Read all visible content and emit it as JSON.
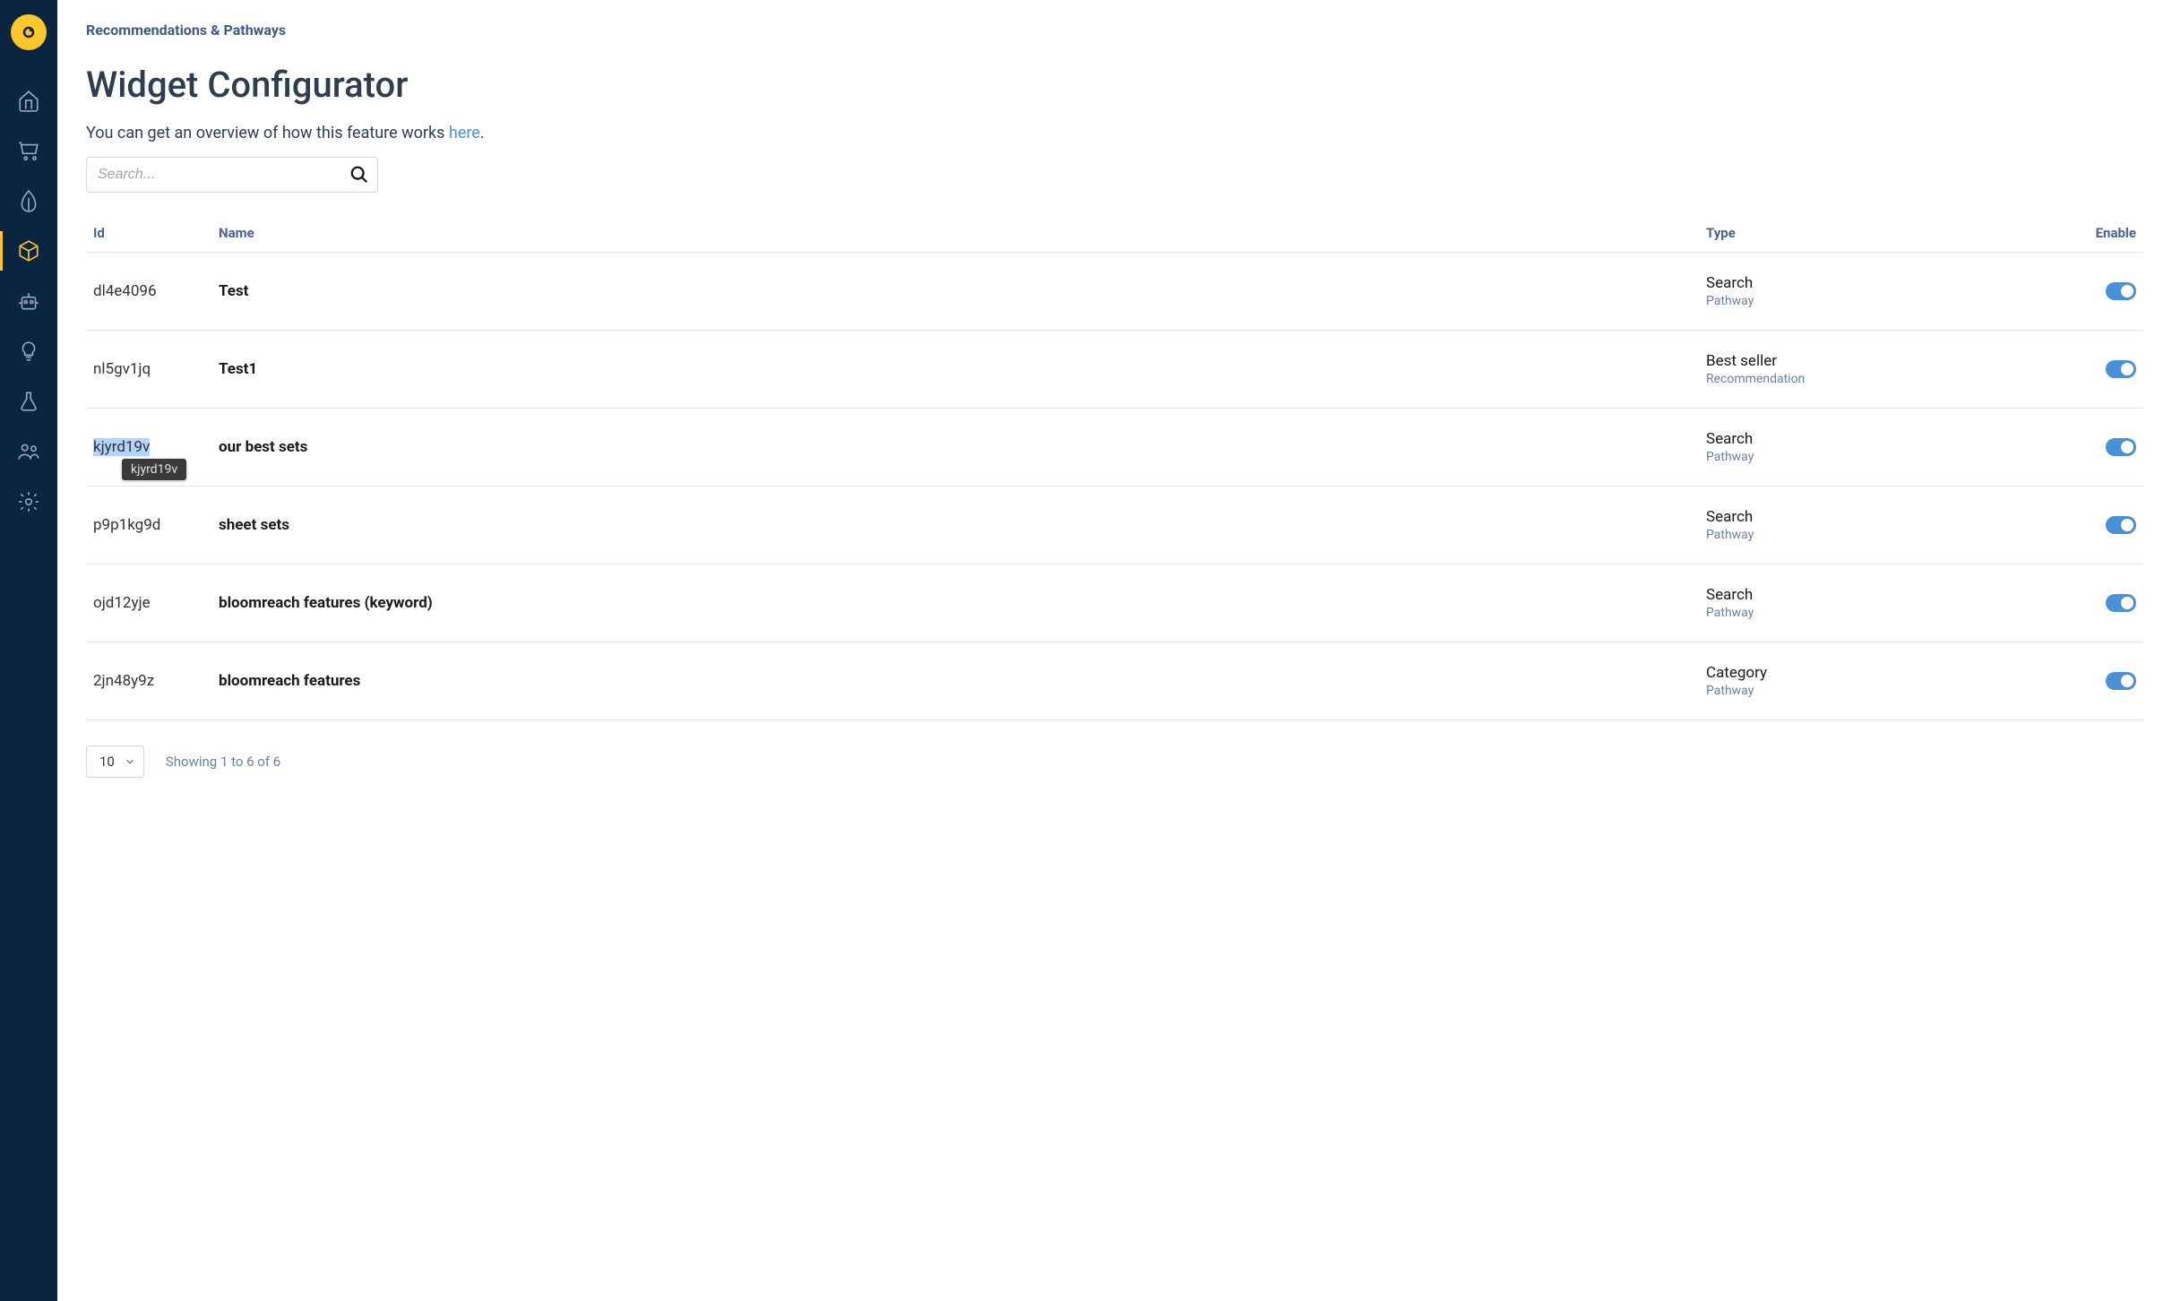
{
  "breadcrumb": "Recommendations & Pathways",
  "page_title": "Widget Configurator",
  "overview": {
    "text_before": "You can get an overview of how this feature works ",
    "link_text": "here",
    "text_after": "."
  },
  "search": {
    "placeholder": "Search..."
  },
  "table": {
    "headers": {
      "id": "Id",
      "name": "Name",
      "type": "Type",
      "enable": "Enable"
    },
    "rows": [
      {
        "id": "dl4e4096",
        "name": "Test",
        "type_main": "Search",
        "type_sub": "Pathway",
        "enabled": true,
        "highlighted": false
      },
      {
        "id": "nl5gv1jq",
        "name": "Test1",
        "type_main": "Best seller",
        "type_sub": "Recommendation",
        "enabled": true,
        "highlighted": false
      },
      {
        "id": "kjyrd19v",
        "name": "our best sets",
        "type_main": "Search",
        "type_sub": "Pathway",
        "enabled": true,
        "highlighted": true,
        "tooltip": "kjyrd19v"
      },
      {
        "id": "p9p1kg9d",
        "name": "sheet sets",
        "type_main": "Search",
        "type_sub": "Pathway",
        "enabled": true,
        "highlighted": false
      },
      {
        "id": "ojd12yje",
        "name": "bloomreach features (keyword)",
        "type_main": "Search",
        "type_sub": "Pathway",
        "enabled": true,
        "highlighted": false
      },
      {
        "id": "2jn48y9z",
        "name": "bloomreach features",
        "type_main": "Category",
        "type_sub": "Pathway",
        "enabled": true,
        "highlighted": false
      }
    ]
  },
  "pagination": {
    "page_size": "10",
    "showing": "Showing 1 to 6 of 6"
  },
  "nav": {
    "items": [
      "home",
      "cart",
      "leaf",
      "cube",
      "robot",
      "bulb",
      "flask",
      "people",
      "gear"
    ],
    "active_index": 3
  }
}
